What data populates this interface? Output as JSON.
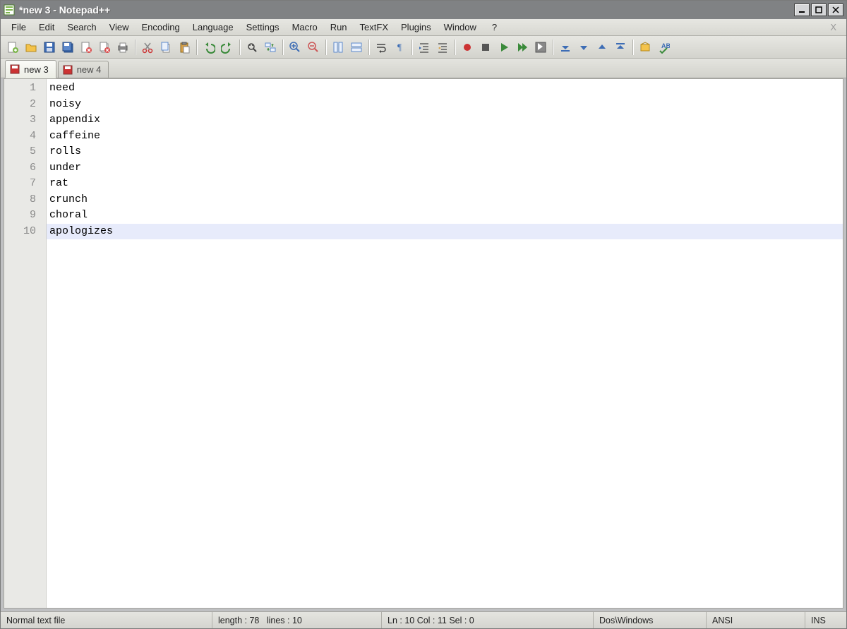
{
  "window": {
    "title": "*new 3 - Notepad++"
  },
  "menu": {
    "items": [
      "File",
      "Edit",
      "Search",
      "View",
      "Encoding",
      "Language",
      "Settings",
      "Macro",
      "Run",
      "TextFX",
      "Plugins",
      "Window"
    ],
    "help": "?"
  },
  "tabs": [
    {
      "label": "new 3",
      "active": true,
      "dirty": true
    },
    {
      "label": "new 4",
      "active": false,
      "dirty": true
    }
  ],
  "editor": {
    "lines": [
      "need",
      "noisy",
      "appendix",
      "caffeine",
      "rolls",
      "under",
      "rat",
      "crunch",
      "choral",
      "apologizes"
    ],
    "current_line_index": 9
  },
  "status": {
    "filetype": "Normal text file",
    "length_label": "length : 78",
    "lines_label": "lines : 10",
    "pos_label": "Ln : 10    Col : 11    Sel : 0",
    "eol": "Dos\\Windows",
    "encoding": "ANSI",
    "mode": "INS"
  },
  "toolbar_icons": [
    "new-file-icon",
    "open-file-icon",
    "save-icon",
    "save-all-icon",
    "close-icon",
    "close-all-icon",
    "print-icon",
    "sep",
    "cut-icon",
    "copy-icon",
    "paste-icon",
    "sep",
    "undo-icon",
    "redo-icon",
    "sep",
    "find-icon",
    "replace-icon",
    "sep",
    "zoom-in-icon",
    "zoom-out-icon",
    "sep",
    "sync-v-icon",
    "sync-h-icon",
    "sep",
    "wordwrap-icon",
    "show-all-icon",
    "sep",
    "indent-icon",
    "outdent-icon",
    "sep",
    "record-macro-icon",
    "stop-macro-icon",
    "play-macro-icon",
    "play-multi-icon",
    "save-macro-icon",
    "sep",
    "func-start-icon",
    "func-up-icon",
    "func-down-icon",
    "func-end-icon",
    "sep",
    "preferences-icon",
    "spellcheck-icon"
  ]
}
